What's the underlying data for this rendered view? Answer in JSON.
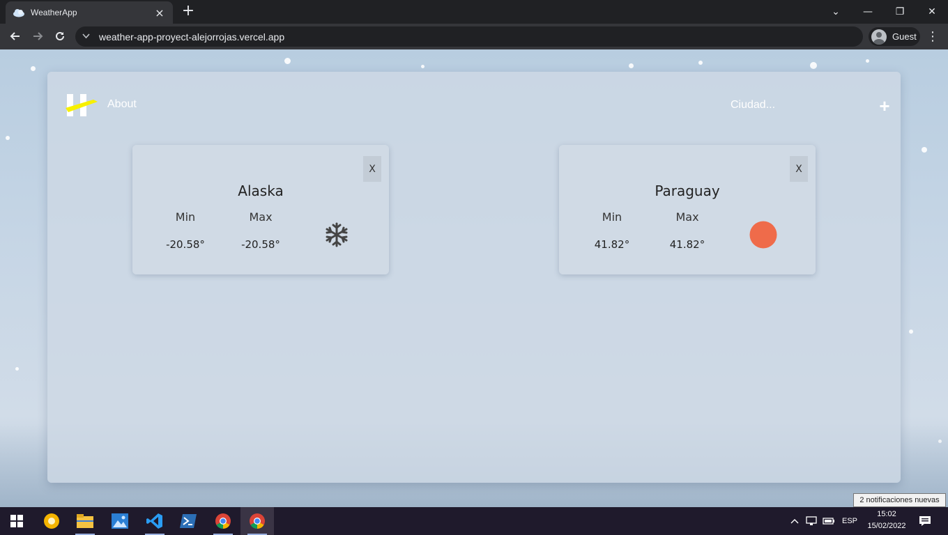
{
  "browser": {
    "tab_title": "WeatherApp",
    "tab_close": "×",
    "new_tab": "+",
    "url": "weather-app-proyect-alejorrojas.vercel.app",
    "profile_label": "Guest",
    "menu": "⋮",
    "win_minimize": "—",
    "win_restore": "❐",
    "win_close": "✕",
    "tab_search": "⌄"
  },
  "app": {
    "nav_about": "About",
    "search": {
      "placeholder": "Ciudad..."
    },
    "add_label": "+",
    "cards": [
      {
        "city": "Alaska",
        "min_label": "Min",
        "max_label": "Max",
        "min": "-20.58°",
        "max": "-20.58°",
        "icon": "snowflake-icon",
        "close": "X"
      },
      {
        "city": "Paraguay",
        "min_label": "Min",
        "max_label": "Max",
        "min": "41.82°",
        "max": "41.82°",
        "icon": "sun-icon",
        "icon_color": "#ef6b4a",
        "close": "X"
      }
    ]
  },
  "taskbar": {
    "language": "ESP",
    "time": "15:02",
    "date": "15/02/2022",
    "notification_tooltip": "2 notificaciones nuevas"
  }
}
